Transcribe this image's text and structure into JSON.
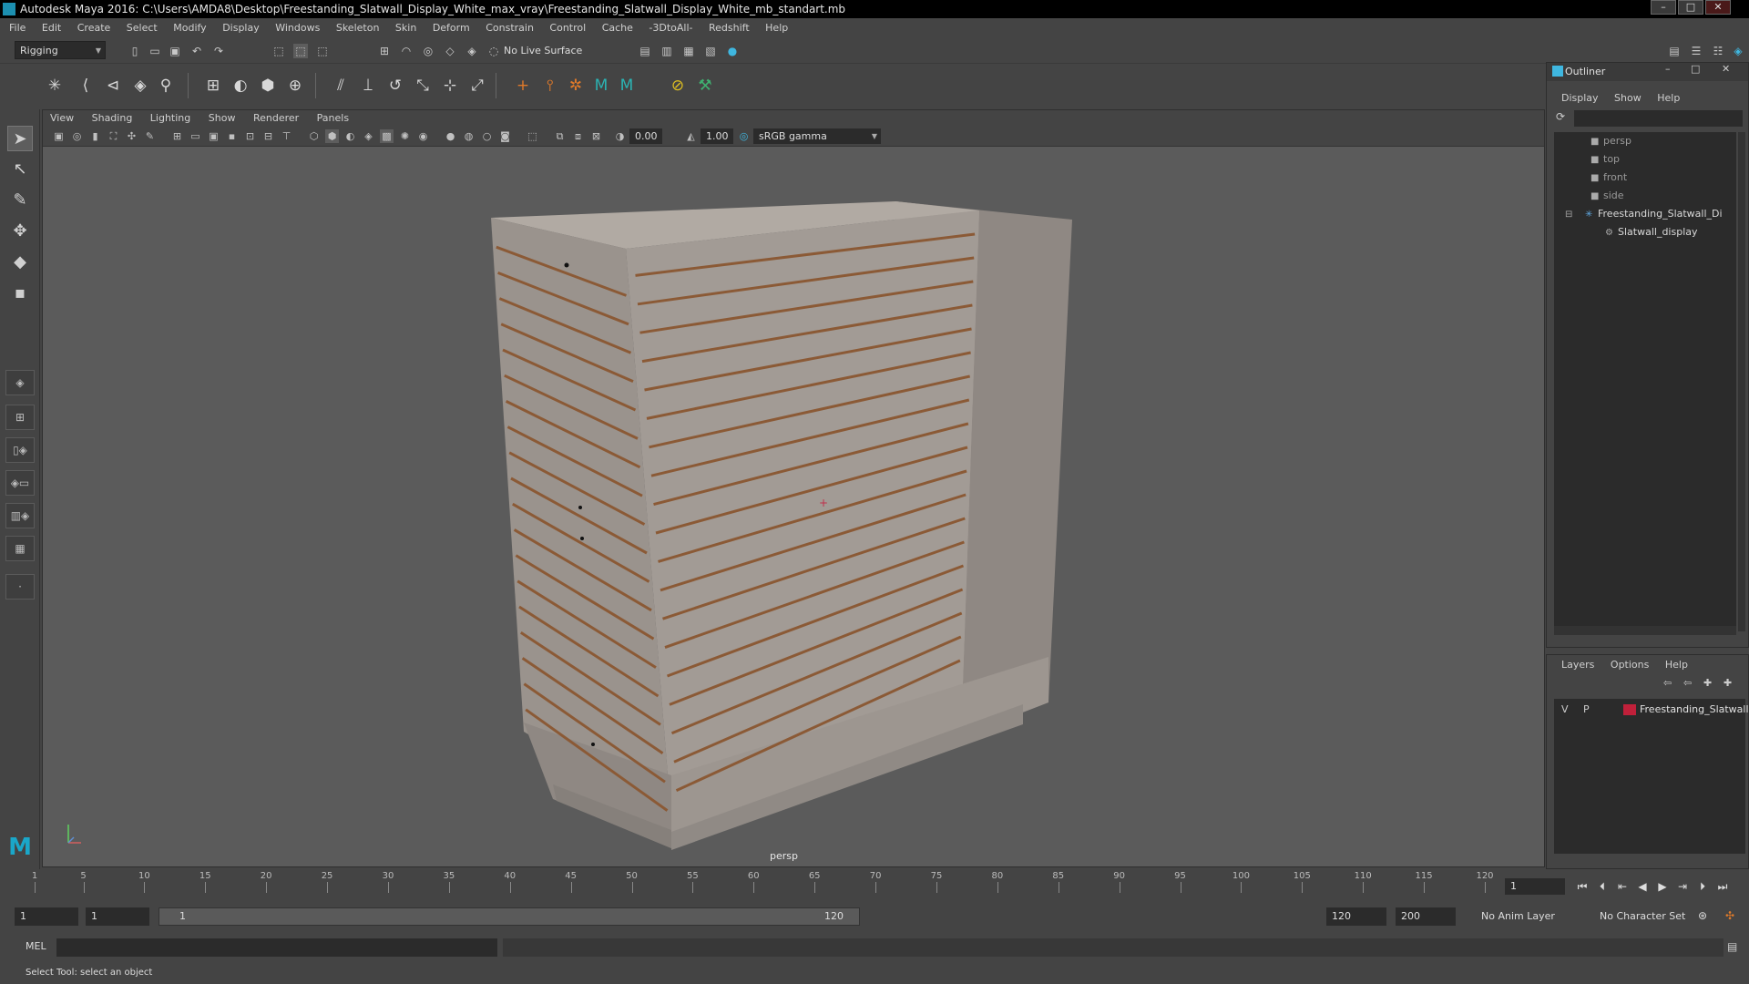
{
  "window": {
    "title": "Autodesk Maya 2016: C:\\Users\\AMDA8\\Desktop\\Freestanding_Slatwall_Display_White_max_vray\\Freestanding_Slatwall_Display_White_mb_standart.mb"
  },
  "menubar": [
    "File",
    "Edit",
    "Create",
    "Select",
    "Modify",
    "Display",
    "Windows",
    "Skeleton",
    "Skin",
    "Deform",
    "Constrain",
    "Control",
    "Cache",
    "-3DtoAll-",
    "Redshift",
    "Help"
  ],
  "statusline": {
    "menuset": "Rigging",
    "live_surface": "No Live Surface"
  },
  "viewport": {
    "panel_menus": [
      "View",
      "Shading",
      "Lighting",
      "Show",
      "Renderer",
      "Panels"
    ],
    "exposure": "0.00",
    "gamma": "1.00",
    "color_space": "sRGB gamma",
    "camera": "persp"
  },
  "outliner": {
    "title": "Outliner",
    "menus": [
      "Display",
      "Show",
      "Help"
    ],
    "items": [
      {
        "label": "persp",
        "icon": "camera-icon"
      },
      {
        "label": "top",
        "icon": "camera-icon"
      },
      {
        "label": "front",
        "icon": "camera-icon"
      },
      {
        "label": "side",
        "icon": "camera-icon"
      },
      {
        "label": "Freestanding_Slatwall_Di",
        "icon": "joint-icon"
      },
      {
        "label": "Slatwall_display",
        "icon": "mesh-icon"
      }
    ]
  },
  "layers": {
    "menus": [
      "Layers",
      "Options",
      "Help"
    ],
    "row": {
      "v": "V",
      "p": "P",
      "name": "Freestanding_Slatwall",
      "color": "#c0203a"
    }
  },
  "timeline": {
    "ticks": [
      "1",
      "5",
      "10",
      "15",
      "20",
      "25",
      "30",
      "35",
      "40",
      "45",
      "50",
      "55",
      "60",
      "65",
      "70",
      "75",
      "80",
      "85",
      "90",
      "95",
      "100",
      "105",
      "110",
      "115",
      "120"
    ],
    "current_frame": "1"
  },
  "range": {
    "start": "1",
    "playback_start": "1",
    "slider_start": "1",
    "slider_end": "120",
    "playback_end": "120",
    "end": "200",
    "anim_layer": "No Anim Layer",
    "character_set": "No Character Set"
  },
  "command": {
    "label": "MEL"
  },
  "help": {
    "text": "Select Tool: select an object"
  }
}
